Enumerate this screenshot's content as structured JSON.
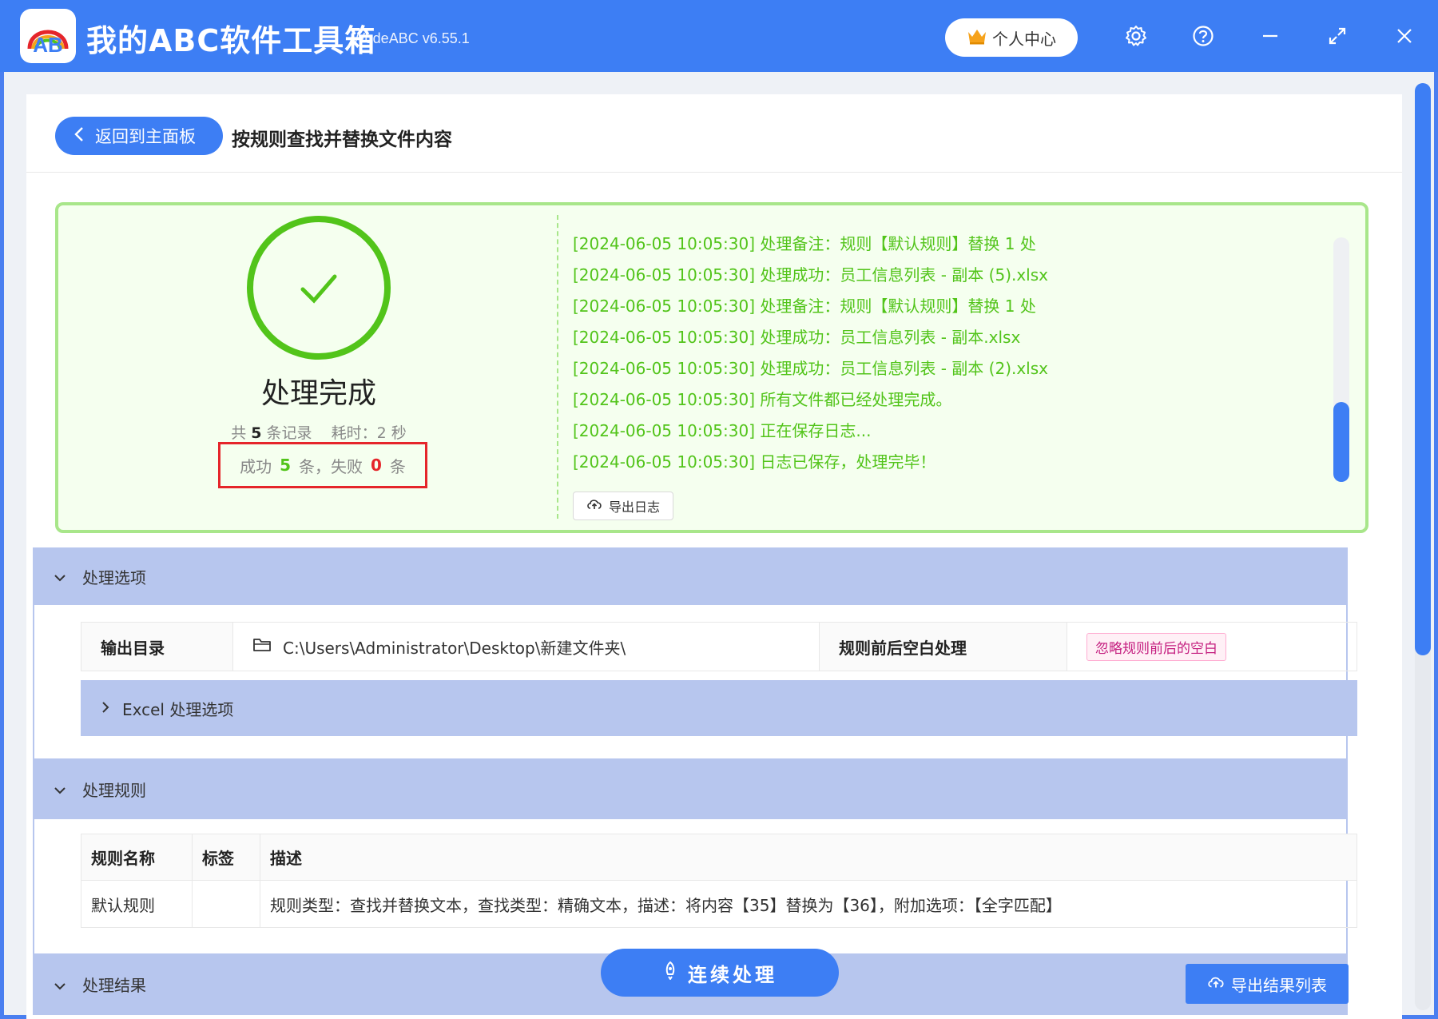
{
  "app": {
    "title": "我的ABC软件工具箱",
    "version": "WodeABC v6.55.1",
    "user_center": "个人中心",
    "logo_text": "AB"
  },
  "colors": {
    "accent": "#3d7ef4",
    "success": "#52c41a",
    "danger": "#e5252a",
    "section": "#b7c6ee"
  },
  "header": {
    "back_label": "返回到主面板",
    "page_title": "按规则查找并替换文件内容"
  },
  "result": {
    "status": "处理完成",
    "total_prefix": "共",
    "total": "5",
    "total_suffix": "条记录",
    "time_label": "耗时：2 秒",
    "success_label": "成功",
    "success_count": "5",
    "fail_label": "条，失败",
    "fail_count": "0",
    "fail_suffix": "条",
    "log": [
      "[2024-06-05 10:05:30] 处理备注：规则【默认规则】替换 1 处",
      "[2024-06-05 10:05:30] 处理成功：员工信息列表 - 副本 (5).xlsx",
      "[2024-06-05 10:05:30] 处理备注：规则【默认规则】替换 1 处",
      "[2024-06-05 10:05:30] 处理成功：员工信息列表 - 副本.xlsx",
      "[2024-06-05 10:05:30] 处理成功：员工信息列表 - 副本 (2).xlsx",
      "[2024-06-05 10:05:30] 所有文件都已经处理完成。",
      "[2024-06-05 10:05:30] 正在保存日志...",
      "[2024-06-05 10:05:30] 日志已保存，处理完毕！"
    ],
    "export_log": "导出日志"
  },
  "options": {
    "title": "处理选项",
    "output_dir_label": "输出目录",
    "output_dir": "C:\\Users\\Administrator\\Desktop\\新建文件夹\\",
    "whitespace_label": "规则前后空白处理",
    "whitespace_tag": "忽略规则前后的空白",
    "excel_title": "Excel 处理选项"
  },
  "rules": {
    "title": "处理规则",
    "columns": [
      "规则名称",
      "标签",
      "描述"
    ],
    "rows": [
      [
        "默认规则",
        "",
        "规则类型：查找并替换文本，查找类型：精确文本，描述：将内容【35】替换为【36】，附加选项：【全字匹配】"
      ]
    ]
  },
  "results_section": {
    "title": "处理结果",
    "continue": "连续处理",
    "export_results": "导出结果列表"
  }
}
